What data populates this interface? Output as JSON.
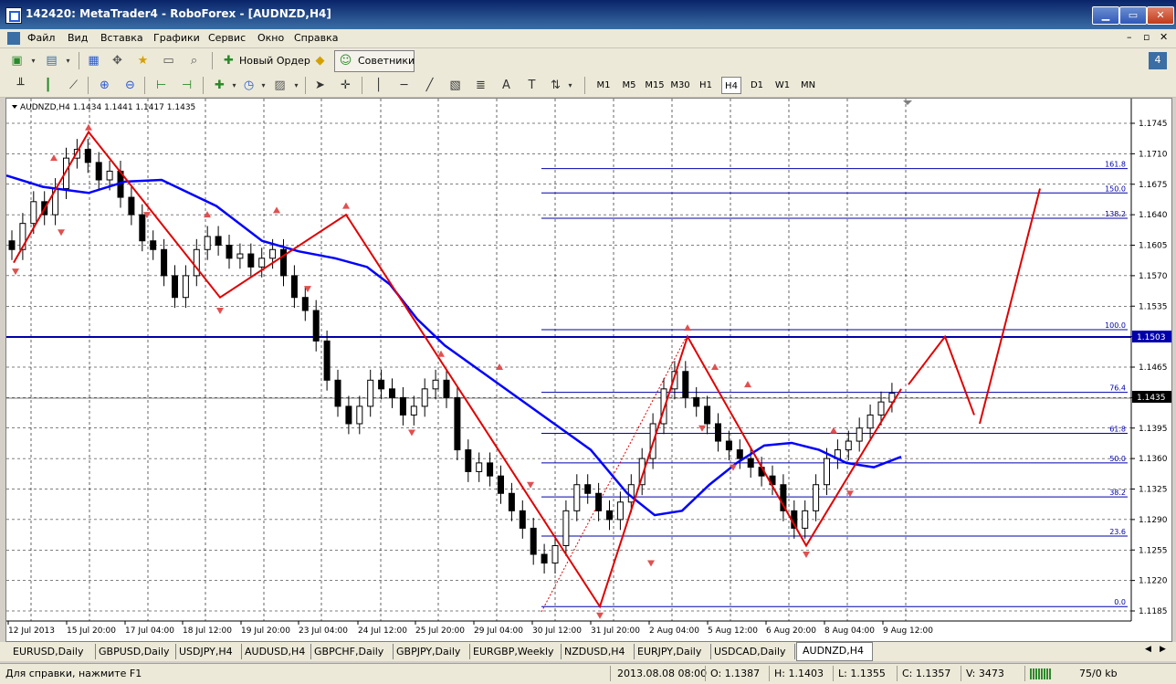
{
  "window": {
    "title": "142420: MetaTrader4 - RoboForex - [AUDNZD,H4]",
    "btn_min": "▁",
    "btn_max": "▭",
    "btn_close": "✕"
  },
  "menu": {
    "items": [
      "Файл",
      "Вид",
      "Вставка",
      "Графики",
      "Сервис",
      "Окно",
      "Справка"
    ],
    "mdi_min": "–",
    "mdi_restore": "▫",
    "mdi_close": "✕"
  },
  "toolbar": {
    "new_order": "Новый Ордер",
    "experts": "Советники",
    "timeframes": [
      "M1",
      "M5",
      "M15",
      "M30",
      "H1",
      "H4",
      "D1",
      "W1",
      "MN"
    ],
    "active_tf": "H4"
  },
  "chart": {
    "info": "AUDNZD,H4  1.1434 1.1441 1.1417 1.1435",
    "price_ticks": [
      "1.1745",
      "1.1710",
      "1.1675",
      "1.1640",
      "1.1605",
      "1.1570",
      "1.1535",
      "1.1500",
      "1.1465",
      "1.1430",
      "1.1395",
      "1.1360",
      "1.1325",
      "1.1290",
      "1.1255",
      "1.1220",
      "1.1185"
    ],
    "price_badges": {
      "level": "1.1503",
      "current": "1.1435"
    },
    "time_labels": [
      "12 Jul 2013",
      "15 Jul 20:00",
      "17 Jul 04:00",
      "18 Jul 12:00",
      "19 Jul 20:00",
      "23 Jul 04:00",
      "24 Jul 12:00",
      "25 Jul 20:00",
      "29 Jul 04:00",
      "30 Jul 12:00",
      "31 Jul 20:00",
      "2 Aug 04:00",
      "5 Aug 12:00",
      "6 Aug 20:00",
      "8 Aug 04:00",
      "9 Aug 12:00"
    ],
    "fib_levels": [
      "161.8",
      "150.0",
      "138.2",
      "100.0",
      "76.4",
      "61.8",
      "50.0",
      "38.2",
      "23.6",
      "0.0"
    ],
    "colors": {
      "candle": "#000000",
      "zigzag": "#e00000",
      "ma": "#0000ff",
      "fib": "#0000aa",
      "level_line": "#0000aa",
      "bg": "#ffffff"
    }
  },
  "tabs": {
    "items": [
      "EURUSD,Daily",
      "GBPUSD,Daily",
      "USDJPY,H4",
      "AUDUSD,H4",
      "GBPCHF,Daily",
      "GBPJPY,Daily",
      "EURGBP,Weekly",
      "NZDUSD,H4",
      "EURJPY,Daily",
      "USDCAD,Daily",
      "AUDNZD,H4"
    ],
    "active": "AUDNZD,H4"
  },
  "status": {
    "help": "Для справки, нажмите F1",
    "time": "2013.08.08 08:00",
    "open": "O: 1.1387",
    "high": "H: 1.1403",
    "low": "L: 1.1355",
    "close": "C: 1.1357",
    "volume": "V: 3473",
    "traffic": "75/0 kb"
  }
}
